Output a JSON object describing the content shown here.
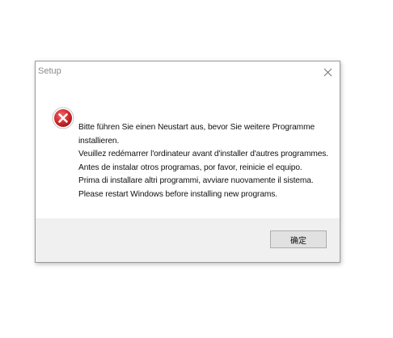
{
  "window": {
    "title": "Setup",
    "close_icon": "close-icon"
  },
  "message": {
    "icon": "error-icon",
    "lines": [
      "Bitte führen Sie einen Neustart aus, bevor Sie weitere Programme",
      "installieren.",
      "Veuillez redémarrer l'ordinateur avant d'installer d'autres programmes.",
      "Antes de instalar otros programas, por favor, reinicie el equipo.",
      "Prima di installare altri programmi, avviare nuovamente il sistema.",
      "Please restart Windows before installing new programs."
    ]
  },
  "footer": {
    "ok_label": "确定"
  },
  "colors": {
    "footer_bg": "#f0f0f0",
    "error_red": "#c8282c"
  }
}
